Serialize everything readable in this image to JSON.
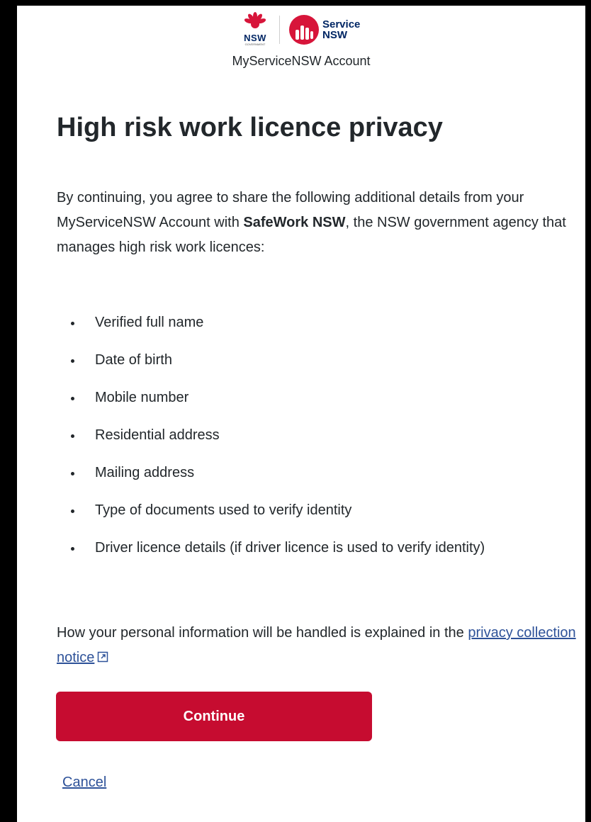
{
  "header": {
    "nsw_logo_text": "NSW",
    "nsw_logo_subtext": "GOVERNMENT",
    "service_logo_line1": "Service",
    "service_logo_line2": "NSW",
    "account_label": "MyServiceNSW Account"
  },
  "main": {
    "title": "High risk work licence privacy",
    "intro_before": "By continuing, you agree to share the following additional details from your MyServiceNSW Account with ",
    "intro_agency": "SafeWork NSW",
    "intro_after": ", the NSW government agency that manages high risk work licences:",
    "details": [
      "Verified full name",
      "Date of birth",
      "Mobile number",
      "Residential address",
      "Mailing address",
      "Type of documents used to verify identity",
      "Driver licence details (if driver licence is used to verify identity)"
    ],
    "handled_text": "How your personal information will be handled is explained in the ",
    "privacy_link": "privacy collection notice",
    "continue_label": "Continue",
    "cancel_label": "Cancel"
  },
  "colors": {
    "brand_red": "#c60c30",
    "brand_navy": "#002664",
    "link_blue": "#2e5299",
    "text": "#22272b"
  },
  "icons": {
    "nsw": "waratah-icon",
    "service": "service-nsw-emblem-icon",
    "external": "external-link-icon"
  }
}
